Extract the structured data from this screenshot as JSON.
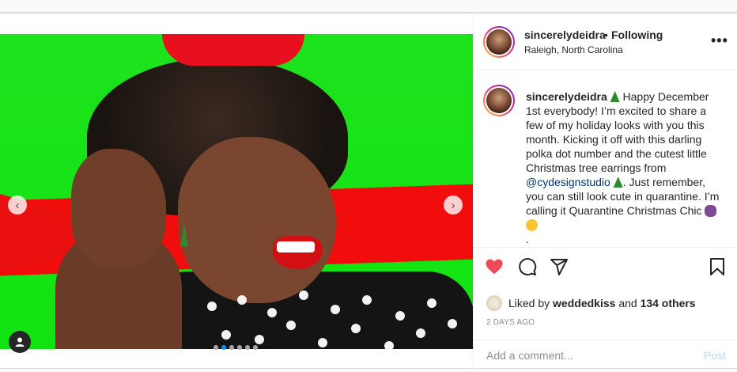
{
  "post": {
    "username": "sincerelydeidra",
    "following_label": "Following",
    "location": "Raleigh, North Carolina",
    "more_label": "•••",
    "caption": {
      "username": "sincerelydeidra",
      "part1": "Happy December 1st everybody! I’m excited to share a few of my holiday looks with you this month. Kicking it off with this darling polka dot number and the cutest little Christmas tree earrings from",
      "mention": "@cydesignstudio",
      "part2": ". Just remember, you can still look cute in quarantine. I’m calling it Quarantine Christmas Chic",
      "trailing": "."
    },
    "carousel": {
      "total": 6,
      "active": 2
    },
    "likes": {
      "prefix": "Liked by",
      "user": "weddedkiss",
      "middle": "and",
      "others": "134 others"
    },
    "timestamp": "2 DAYS AGO",
    "comment_box": {
      "placeholder": "Add a comment...",
      "post_label": "Post"
    },
    "nav": {
      "prev": "‹",
      "next": "›"
    }
  },
  "colors": {
    "like_red": "#ed4956",
    "link_blue": "#00376b",
    "post_disabled": "#b2dffc",
    "pager_active": "#0095f6"
  },
  "icons": [
    "chevron-left-icon",
    "chevron-right-icon",
    "user-tag-icon",
    "more-icon",
    "heart-icon",
    "comment-icon",
    "share-icon",
    "bookmark-icon"
  ]
}
